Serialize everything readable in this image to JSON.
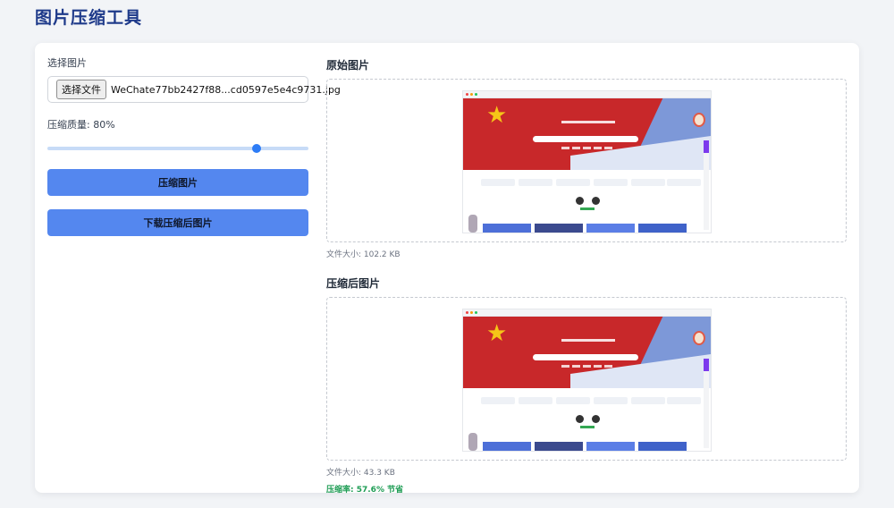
{
  "app": {
    "title": "图片压缩工具"
  },
  "left": {
    "select_label": "选择图片",
    "file_button": "选择文件",
    "file_name": "WeChate77bb2427f88...cd0597e5e4c9731.jpg",
    "quality_label": "压缩质量: 80%",
    "quality_value": 0.8,
    "compress_button": "压缩图片",
    "download_button": "下载压缩后图片"
  },
  "original": {
    "title": "原始图片",
    "size": "文件大小: 102.2 KB"
  },
  "compressed": {
    "title": "压缩后图片",
    "size": "文件大小: 43.3 KB",
    "ratio": "压缩率: 57.6% 节省"
  },
  "colors": {
    "accent": "#5487ef",
    "title": "#1e3a8a",
    "success": "#1f9d55",
    "slider_track": "#c7dbf7",
    "slider_thumb": "#2d7cf6"
  }
}
